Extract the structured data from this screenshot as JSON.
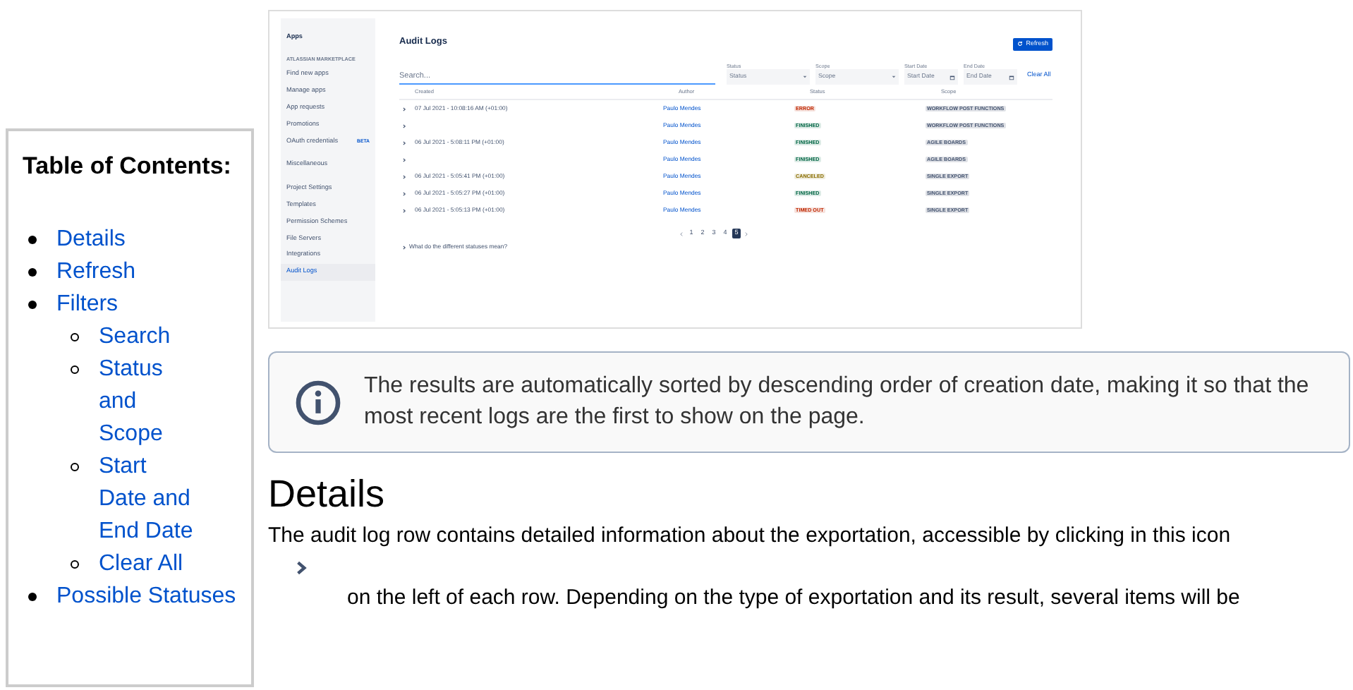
{
  "app_screenshot": {
    "sidebar": {
      "heading": "Apps",
      "section": "ATLASSIAN MARKETPLACE",
      "items": [
        {
          "label": "Find new apps",
          "selected": false
        },
        {
          "label": "Manage apps",
          "selected": false
        },
        {
          "label": "App requests",
          "selected": false
        },
        {
          "label": "Promotions",
          "selected": false
        },
        {
          "label": "OAuth credentials",
          "badge": "BETA",
          "selected": false
        },
        {
          "label": "Miscellaneous",
          "selected": false
        },
        {
          "label": "Project Settings",
          "selected": false
        },
        {
          "label": "Templates",
          "selected": false
        },
        {
          "label": "Permission Schemes",
          "selected": false
        },
        {
          "label": "File Servers",
          "selected": false
        },
        {
          "label": "Integrations",
          "selected": false
        },
        {
          "label": "Audit Logs",
          "selected": true
        }
      ]
    },
    "title": "Audit Logs",
    "refresh_button": "Refresh",
    "search": {
      "placeholder": "Search..."
    },
    "filters": [
      {
        "label": "Status",
        "placeholder": "Status",
        "kind": "select"
      },
      {
        "label": "Scope",
        "placeholder": "Scope",
        "kind": "select"
      },
      {
        "label": "Start Date",
        "placeholder": "Start Date",
        "kind": "date"
      },
      {
        "label": "End Date",
        "placeholder": "End Date",
        "kind": "date"
      }
    ],
    "clear_all": "Clear All",
    "table": {
      "columns": [
        "Created",
        "Author",
        "Status",
        "Scope"
      ],
      "rows": [
        {
          "created": "07 Jul 2021 - 10:08:16 AM (+01:00)",
          "author": "Paulo Mendes",
          "status": "ERROR",
          "color": "#bf2600",
          "scope": "WORKFLOW POST FUNCTIONS"
        },
        {
          "author": "Paulo Mendes",
          "status": "FINISHED",
          "color": "#006644",
          "scope": "WORKFLOW POST FUNCTIONS"
        },
        {
          "created": "06 Jul 2021 - 5:08:11 PM (+01:00)",
          "author": "Paulo Mendes",
          "status": "FINISHED",
          "color": "#006644",
          "scope": "AGILE BOARDS"
        },
        {
          "author": "Paulo Mendes",
          "status": "FINISHED",
          "color": "#006644",
          "scope": "AGILE BOARDS"
        },
        {
          "created": "06 Jul 2021 - 5:05:41 PM (+01:00)",
          "author": "Paulo Mendes",
          "status": "CANCELED",
          "color": "#8a6d00",
          "scope": "SINGLE EXPORT"
        },
        {
          "created": "06 Jul 2021 - 5:05:27 PM (+01:00)",
          "author": "Paulo Mendes",
          "status": "FINISHED",
          "color": "#006644",
          "scope": "SINGLE EXPORT"
        },
        {
          "created": "06 Jul 2021 - 5:05:13 PM (+01:00)",
          "author": "Paulo Mendes",
          "status": "TIMED OUT",
          "color": "#bf2600",
          "scope": "SINGLE EXPORT"
        }
      ]
    },
    "pagination": [
      {
        "label": "1",
        "selected": false
      },
      {
        "label": "2",
        "selected": false
      },
      {
        "label": "3",
        "selected": false
      },
      {
        "label": "4",
        "selected": false
      },
      {
        "label": "5",
        "selected": true
      }
    ],
    "statuses_link": "What do the different statuses mean?"
  },
  "info": {
    "text": "The results are automatically sorted by descending order of creation date, making it so that the most recent logs are the first to show on the page."
  },
  "details": {
    "heading": "Details",
    "paragraph": "The audit log row contains detailed information about the exportation, accessible by clicking in this icon",
    "continuation": "on the left of each row. Depending on the type of exportation and its result, several items will be"
  },
  "toc": {
    "heading": "Table of Contents:",
    "items": [
      {
        "label": "Details"
      },
      {
        "label": "Refresh"
      },
      {
        "label": "Filters",
        "children": [
          {
            "label": "Search"
          },
          {
            "label": "Status and Scope"
          },
          {
            "label": "Start Date and End Date"
          },
          {
            "label": "Clear All"
          }
        ]
      },
      {
        "label": "Possible Statuses"
      }
    ]
  }
}
